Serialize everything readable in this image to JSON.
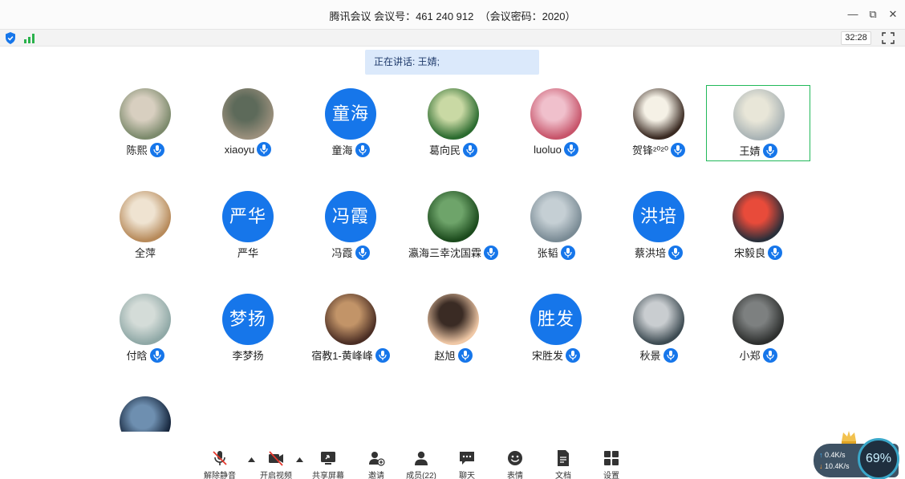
{
  "window": {
    "title": "腾讯会议 会议号：461 240 912  （会议密码：2020）",
    "controls": {
      "minimize": "—",
      "restore": "⧉",
      "close": "✕"
    }
  },
  "status": {
    "timer": "32:28",
    "icons": [
      "shield-icon",
      "signal-icon",
      "fullscreen-icon"
    ]
  },
  "speaking": {
    "text": "正在讲话: 王婧;"
  },
  "colors": {
    "accent": "#1676ea",
    "highlight_border": "#22b95a",
    "banner": "#dbe9fb",
    "mic_muted": "#e5372c"
  },
  "participants": [
    {
      "name": "陈熙",
      "avatar": "photo",
      "mic": true
    },
    {
      "name": "xiaoyu",
      "avatar": "photo",
      "mic": true
    },
    {
      "name": "童海",
      "avatar_text": "童海",
      "avatar": "text",
      "mic": true
    },
    {
      "name": "葛向民",
      "avatar": "photo",
      "mic": true
    },
    {
      "name": "luoluo",
      "avatar": "photo",
      "mic": true
    },
    {
      "name": "贺锋²⁰²⁰",
      "avatar": "photo",
      "mic": true
    },
    {
      "name": "王婧",
      "avatar": "photo",
      "mic": true,
      "speaking": true
    },
    {
      "name": "全萍",
      "avatar": "photo",
      "mic": false
    },
    {
      "name": "严华",
      "avatar_text": "严华",
      "avatar": "text",
      "mic": false
    },
    {
      "name": "冯霞",
      "avatar_text": "冯霞",
      "avatar": "text",
      "mic": true
    },
    {
      "name": "瀛海三幸沈国霖",
      "avatar": "photo",
      "mic": true
    },
    {
      "name": "张韬",
      "avatar": "photo",
      "mic": true
    },
    {
      "name": "蔡洪培",
      "avatar_text": "洪培",
      "avatar": "text",
      "mic": true
    },
    {
      "name": "宋毅良",
      "avatar": "photo",
      "mic": true
    },
    {
      "name": "付晗",
      "avatar": "photo",
      "mic": true
    },
    {
      "name": "李梦扬",
      "avatar_text": "梦扬",
      "avatar": "text",
      "mic": false
    },
    {
      "name": "宿教1-黄峰峰",
      "avatar": "photo",
      "mic": true
    },
    {
      "name": "赵旭",
      "avatar": "photo",
      "mic": true
    },
    {
      "name": "宋胜发",
      "avatar_text": "胜发",
      "avatar": "text",
      "mic": true
    },
    {
      "name": "秋景",
      "avatar": "photo",
      "mic": true
    },
    {
      "name": "小郑",
      "avatar": "photo",
      "mic": true
    },
    {
      "name": "",
      "avatar": "photo",
      "mic": false
    }
  ],
  "toolbar": {
    "unmute": "解除静音",
    "start_video": "开启视频",
    "share_screen": "共享屏幕",
    "invite": "邀请",
    "members": "成员(22)",
    "chat": "聊天",
    "reactions": "表情",
    "docs": "文档",
    "settings": "设置"
  },
  "network": {
    "upload": "0.4K/s",
    "download": "10.4K/s",
    "percent": "69%"
  }
}
